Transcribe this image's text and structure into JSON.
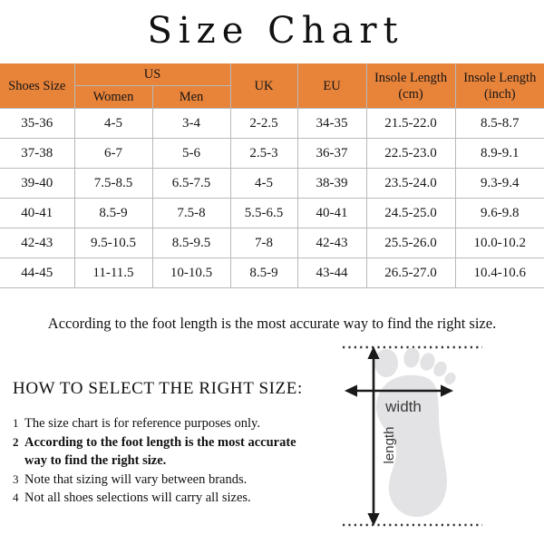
{
  "title": "Size Chart",
  "table": {
    "headers": {
      "shoes_size": "Shoes Size",
      "us": "US",
      "women": "Women",
      "men": "Men",
      "uk": "UK",
      "eu": "EU",
      "insole_cm": "Insole Length (cm)",
      "insole_inch": "Insole Length (inch)"
    },
    "rows": [
      {
        "shoes": "35-36",
        "women": "4-5",
        "men": "3-4",
        "uk": "2-2.5",
        "eu": "34-35",
        "cm": "21.5-22.0",
        "inch": "8.5-8.7"
      },
      {
        "shoes": "37-38",
        "women": "6-7",
        "men": "5-6",
        "uk": "2.5-3",
        "eu": "36-37",
        "cm": "22.5-23.0",
        "inch": "8.9-9.1"
      },
      {
        "shoes": "39-40",
        "women": "7.5-8.5",
        "men": "6.5-7.5",
        "uk": "4-5",
        "eu": "38-39",
        "cm": "23.5-24.0",
        "inch": "9.3-9.4"
      },
      {
        "shoes": "40-41",
        "women": "8.5-9",
        "men": "7.5-8",
        "uk": "5.5-6.5",
        "eu": "40-41",
        "cm": "24.5-25.0",
        "inch": "9.6-9.8"
      },
      {
        "shoes": "42-43",
        "women": "9.5-10.5",
        "men": "8.5-9.5",
        "uk": "7-8",
        "eu": "42-43",
        "cm": "25.5-26.0",
        "inch": "10.0-10.2"
      },
      {
        "shoes": "44-45",
        "women": "11-11.5",
        "men": "10-10.5",
        "uk": "8.5-9",
        "eu": "43-44",
        "cm": "26.5-27.0",
        "inch": "10.4-10.6"
      }
    ]
  },
  "accuracy_note": "According to the foot length is the most accurate way to find the right size.",
  "how_to_select": {
    "heading": "HOW TO SELECT THE RIGHT SIZE:",
    "tips": [
      {
        "num": "1",
        "text": "The size chart is for reference purposes only.",
        "bold": false
      },
      {
        "num": "2",
        "text": "According to the foot length is the most accurate way to find the right size.",
        "bold": true
      },
      {
        "num": "3",
        "text": "Note that sizing will vary between brands.",
        "bold": false
      },
      {
        "num": "4",
        "text": "Not all shoes selections will carry all sizes.",
        "bold": false
      }
    ]
  },
  "foot_diagram": {
    "width_label": "width",
    "length_label": "length",
    "foot_color": "#E3E3E5",
    "arrow_color": "#1a1a1a",
    "guide_color": "#333333",
    "label_color": "#3a3a3a"
  },
  "colors": {
    "header_orange": "#E8833A",
    "border_gray": "#b9b9b9",
    "text": "#111111"
  }
}
